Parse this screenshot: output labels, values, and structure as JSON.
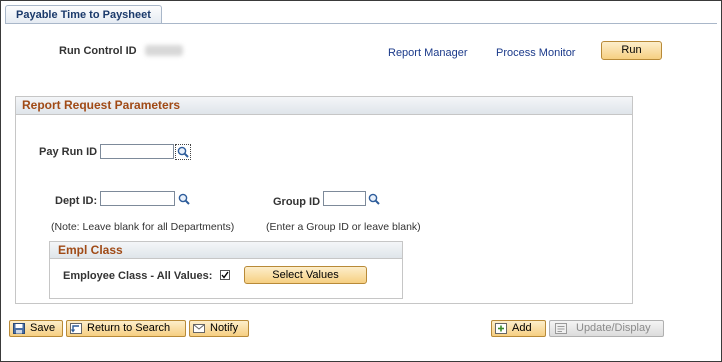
{
  "tab": {
    "title": "Payable Time to Paysheet"
  },
  "header": {
    "run_control_label": "Run Control ID",
    "report_manager": "Report Manager",
    "process_monitor": "Process Monitor",
    "run_button": "Run"
  },
  "params": {
    "title": "Report Request Parameters",
    "pay_run_id_label": "Pay Run ID",
    "pay_run_id_value": "",
    "dept_id_label": "Dept ID:",
    "dept_id_value": "",
    "group_id_label": "Group ID",
    "group_id_value": "",
    "dept_note": "(Note: Leave blank for all Departments)",
    "group_note": "(Enter a Group ID or leave blank)"
  },
  "empl_class": {
    "title": "Empl Class",
    "all_values_label": "Employee Class - All Values:",
    "all_values_checked": true,
    "select_values_button": "Select Values"
  },
  "toolbar": {
    "save": "Save",
    "return_to_search": "Return to Search",
    "notify": "Notify",
    "add": "Add",
    "update_display": "Update/Display"
  },
  "colors": {
    "button_fill": "#f6cf82",
    "section_title": "#a04a16",
    "link": "#1b3a8a"
  }
}
